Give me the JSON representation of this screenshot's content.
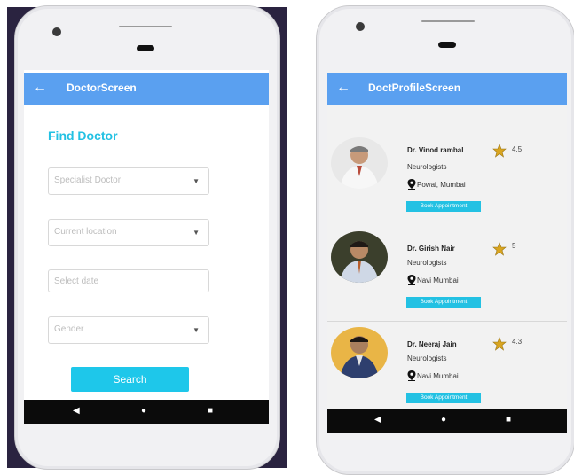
{
  "colors": {
    "appbar": "#5aa0f0",
    "accent": "#23c1e3",
    "navbar": "#0b0b0b"
  },
  "left": {
    "appbar": {
      "back_icon": "arrow-left-icon",
      "title": "DoctorScreen"
    },
    "heading": "Find Doctor",
    "fields": {
      "specialist": "Specialist Doctor",
      "location": "Current location",
      "date": "Select date",
      "gender": "Gender"
    },
    "search_label": "Search",
    "nav_icons": [
      "back-triangle-icon",
      "home-circle-icon",
      "recents-square-icon"
    ]
  },
  "right": {
    "appbar": {
      "back_icon": "arrow-left-icon",
      "title": "DoctProfileScreen"
    },
    "doctors": [
      {
        "name": "Dr. Vinod rambal",
        "specialty": "Neurologists",
        "location": "Powai, Mumbai",
        "rating": "4.5",
        "book": "Book Appointment"
      },
      {
        "name": "Dr. Girish Nair",
        "specialty": "Neurologists",
        "location": "Navi Mumbai",
        "rating": "5",
        "book": "Book Appointment"
      },
      {
        "name": "Dr. Neeraj Jain",
        "specialty": "Neurologists",
        "location": "Navi Mumbai",
        "rating": "4.3",
        "book": "Book Appointment"
      }
    ]
  },
  "glyphs": {
    "back_arrow": "←",
    "caret": "▼",
    "nav_back": "◀",
    "nav_home": "●",
    "nav_recent": "■"
  }
}
